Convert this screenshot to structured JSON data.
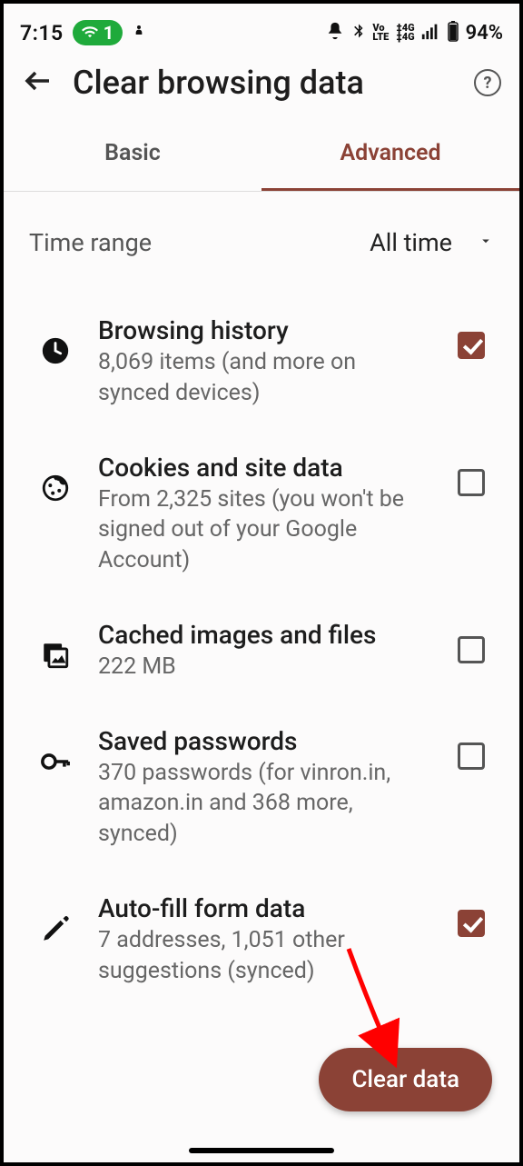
{
  "statusbar": {
    "time": "7:15",
    "wifi_count": "1",
    "battery": "94%"
  },
  "header": {
    "title": "Clear browsing data"
  },
  "tabs": {
    "basic": "Basic",
    "advanced": "Advanced"
  },
  "time_range": {
    "label": "Time range",
    "value": "All time"
  },
  "items": [
    {
      "title": "Browsing history",
      "subtitle": "8,069 items (and more on synced devices)",
      "checked": true
    },
    {
      "title": "Cookies and site data",
      "subtitle": "From 2,325 sites (you won't be signed out of your Google Account)",
      "checked": false
    },
    {
      "title": "Cached images and files",
      "subtitle": "222 MB",
      "checked": false
    },
    {
      "title": "Saved passwords",
      "subtitle": "370 passwords (for vinron.in, amazon.in and 368 more, synced)",
      "checked": false
    },
    {
      "title": "Auto-fill form data",
      "subtitle": "7 addresses, 1,051 other suggestions (synced)",
      "checked": true
    }
  ],
  "action": {
    "clear": "Clear data"
  }
}
